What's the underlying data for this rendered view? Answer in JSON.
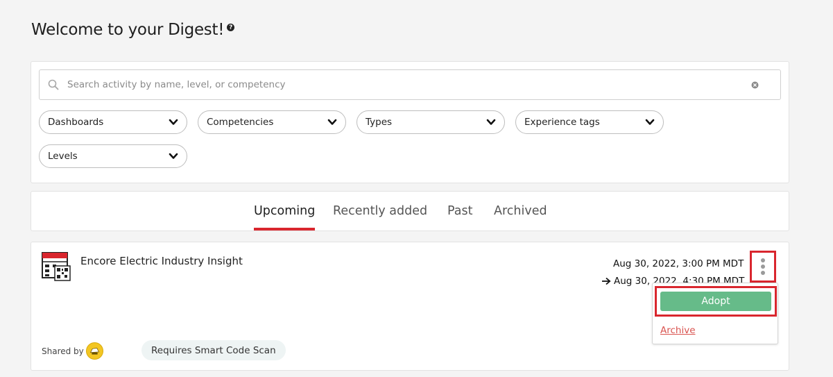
{
  "header": {
    "title": "Welcome to your Digest!",
    "help_glyph": "?"
  },
  "search": {
    "placeholder": "Search activity by name, level, or competency",
    "value": ""
  },
  "filters": [
    {
      "label": "Dashboards"
    },
    {
      "label": "Competencies"
    },
    {
      "label": "Types"
    },
    {
      "label": "Experience tags"
    },
    {
      "label": "Levels"
    }
  ],
  "tabs": [
    {
      "label": "Upcoming",
      "active": true
    },
    {
      "label": "Recently added",
      "active": false
    },
    {
      "label": "Past",
      "active": false
    },
    {
      "label": "Archived",
      "active": false
    }
  ],
  "activity": {
    "title": "Encore Electric Industry Insight",
    "start": "Aug 30, 2022, 3:00 PM MDT",
    "end": "Aug 30, 2022, 4:30 PM MDT",
    "shared_by_label": "Shared by",
    "tag": "Requires Smart Code Scan",
    "icon": "calendar-qr-icon"
  },
  "menu": {
    "adopt_label": "Adopt",
    "archive_label": "Archive"
  },
  "colors": {
    "accent_red": "#d9262e",
    "adopt_green": "#66bb89",
    "archive_red": "#d9534f"
  }
}
